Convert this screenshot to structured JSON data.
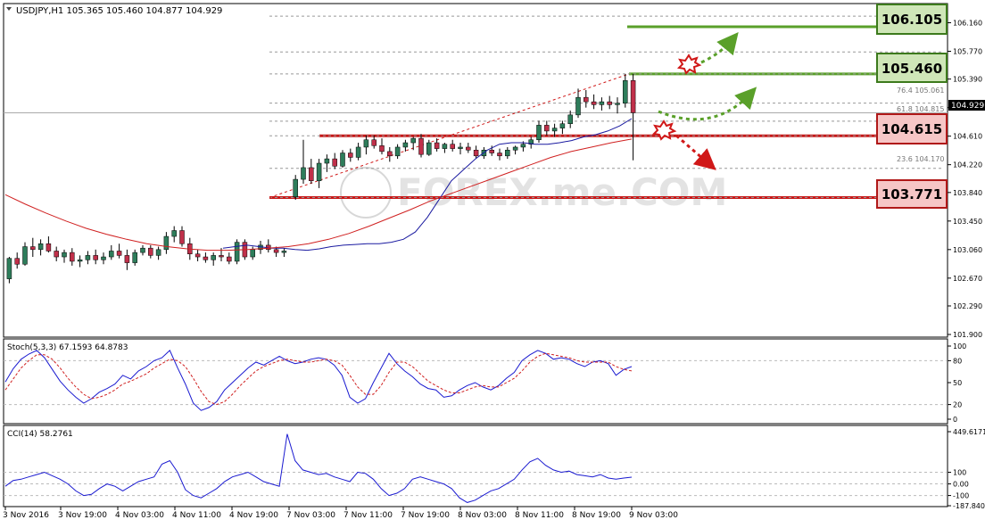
{
  "header": {
    "main_info": "USDJPY,H1  105.365 105.460 104.877 104.929",
    "stoch_info": "Stoch(5,3,3) 67.1593 64.8783",
    "cci_info": "CCI(14) 58.2761"
  },
  "watermark": "FOREX.me.COM",
  "colors": {
    "bull_candle": "#2e7d5b",
    "bear_candle": "#c0304a",
    "ma_fast": "#1a1aa0",
    "ma_slow": "#d02020",
    "resistance": "#5aa02a",
    "support": "#c81818",
    "resistance_label_bg": "#cfe6b8",
    "support_label_bg": "#f6c6c6",
    "indicator_line": "#1a1ad0",
    "signal_line": "#d02020"
  },
  "chart_data": [
    {
      "type": "candlestick",
      "symbol": "USDJPY",
      "timeframe": "H1",
      "ylim": [
        101.9,
        106.3
      ],
      "y_ticks": [
        "106.160",
        "105.770",
        "105.390",
        "105.000",
        "104.610",
        "104.220",
        "103.840",
        "103.450",
        "103.060",
        "102.670",
        "102.290",
        "101.900"
      ],
      "x_ticks": [
        "3 Nov 2016",
        "3 Nov 19:00",
        "4 Nov 03:00",
        "4 Nov 11:00",
        "4 Nov 19:00",
        "7 Nov 03:00",
        "7 Nov 11:00",
        "7 Nov 19:00",
        "8 Nov 03:00",
        "8 Nov 11:00",
        "8 Nov 19:00",
        "9 Nov 03:00"
      ],
      "current_price": "104.929",
      "levels": [
        {
          "label": "106.105",
          "kind": "resistance"
        },
        {
          "label": "105.460",
          "kind": "resistance"
        },
        {
          "label": "104.615",
          "kind": "support"
        },
        {
          "label": "103.771",
          "kind": "support"
        }
      ],
      "fibonacci": [
        {
          "label": "76.4",
          "price": "105.061"
        },
        {
          "label": "61.8",
          "price": "104.815"
        },
        {
          "label": "23.6",
          "price": "104.170"
        }
      ],
      "series": [
        {
          "name": "fast MA",
          "values": [
            103.08,
            103.1,
            103.12,
            103.1,
            103.08,
            103.08,
            103.06,
            103.05,
            103.07,
            103.1,
            103.12,
            103.13,
            103.14,
            103.14,
            103.16,
            103.2,
            103.3,
            103.5,
            103.75,
            104.0,
            104.15,
            104.3,
            104.42,
            104.5,
            104.52,
            104.52,
            104.5,
            104.5,
            104.52,
            104.55,
            104.6,
            104.63,
            104.68,
            104.75,
            104.85
          ]
        },
        {
          "name": "slow MA",
          "values": [
            103.81,
            103.68,
            103.56,
            103.45,
            103.35,
            103.27,
            103.2,
            103.14,
            103.1,
            103.07,
            103.05,
            103.05,
            103.06,
            103.08,
            103.1,
            103.14,
            103.2,
            103.28,
            103.38,
            103.49,
            103.6,
            103.72,
            103.82,
            103.92,
            104.02,
            104.12,
            104.22,
            104.32,
            104.4,
            104.46,
            104.52,
            104.57
          ]
        }
      ],
      "candles": [
        [
          102.66,
          102.96,
          102.6,
          102.94
        ],
        [
          102.94,
          103.02,
          102.8,
          102.86
        ],
        [
          102.86,
          103.16,
          102.84,
          103.1
        ],
        [
          103.1,
          103.22,
          102.96,
          103.06
        ],
        [
          103.06,
          103.2,
          102.98,
          103.14
        ],
        [
          103.14,
          103.24,
          103.02,
          103.04
        ],
        [
          103.04,
          103.1,
          102.9,
          102.96
        ],
        [
          102.96,
          103.06,
          102.88,
          103.02
        ],
        [
          103.02,
          103.08,
          102.84,
          102.9
        ],
        [
          102.9,
          102.98,
          102.82,
          102.92
        ],
        [
          102.92,
          103.04,
          102.86,
          102.98
        ],
        [
          102.98,
          103.06,
          102.86,
          102.92
        ],
        [
          102.92,
          103.02,
          102.86,
          102.96
        ],
        [
          102.96,
          103.12,
          102.92,
          103.04
        ],
        [
          103.04,
          103.14,
          102.94,
          102.98
        ],
        [
          102.98,
          103.06,
          102.78,
          102.88
        ],
        [
          102.88,
          103.06,
          102.84,
          103.02
        ],
        [
          103.02,
          103.12,
          102.98,
          103.08
        ],
        [
          103.08,
          103.12,
          102.94,
          102.98
        ],
        [
          102.98,
          103.1,
          102.92,
          103.06
        ],
        [
          103.06,
          103.3,
          103.0,
          103.24
        ],
        [
          103.24,
          103.38,
          103.16,
          103.32
        ],
        [
          103.32,
          103.38,
          103.1,
          103.14
        ],
        [
          103.14,
          103.22,
          102.92,
          103.0
        ],
        [
          103.0,
          103.06,
          102.9,
          102.96
        ],
        [
          102.96,
          103.02,
          102.88,
          102.92
        ],
        [
          102.92,
          103.02,
          102.84,
          102.98
        ],
        [
          102.98,
          103.08,
          102.9,
          102.96
        ],
        [
          102.96,
          103.02,
          102.86,
          102.9
        ],
        [
          102.9,
          103.2,
          102.86,
          103.16
        ],
        [
          103.16,
          103.2,
          102.92,
          102.96
        ],
        [
          102.96,
          103.1,
          102.92,
          103.06
        ],
        [
          103.06,
          103.18,
          103.0,
          103.12
        ],
        [
          103.12,
          103.2,
          103.02,
          103.06
        ],
        [
          103.06,
          103.1,
          102.96,
          103.02
        ],
        [
          103.02,
          103.08,
          102.96,
          103.04
        ],
        [
          103.78,
          104.08,
          103.74,
          104.02
        ],
        [
          104.02,
          104.56,
          103.96,
          104.18
        ],
        [
          104.18,
          104.3,
          103.96,
          104.0
        ],
        [
          104.0,
          104.3,
          103.9,
          104.24
        ],
        [
          104.24,
          104.36,
          104.12,
          104.3
        ],
        [
          104.3,
          104.38,
          104.16,
          104.2
        ],
        [
          104.2,
          104.42,
          104.18,
          104.38
        ],
        [
          104.38,
          104.44,
          104.26,
          104.32
        ],
        [
          104.32,
          104.52,
          104.28,
          104.46
        ],
        [
          104.46,
          104.62,
          104.36,
          104.56
        ],
        [
          104.56,
          104.62,
          104.44,
          104.48
        ],
        [
          104.48,
          104.58,
          104.36,
          104.4
        ],
        [
          104.4,
          104.46,
          104.26,
          104.34
        ],
        [
          104.34,
          104.5,
          104.3,
          104.46
        ],
        [
          104.46,
          104.56,
          104.4,
          104.52
        ],
        [
          104.52,
          104.6,
          104.42,
          104.58
        ],
        [
          104.58,
          104.64,
          104.32,
          104.36
        ],
        [
          104.36,
          104.56,
          104.34,
          104.52
        ],
        [
          104.52,
          104.58,
          104.4,
          104.44
        ],
        [
          104.44,
          104.52,
          104.38,
          104.5
        ],
        [
          104.5,
          104.56,
          104.4,
          104.44
        ],
        [
          104.44,
          104.52,
          104.36,
          104.46
        ],
        [
          104.46,
          104.52,
          104.38,
          104.42
        ],
        [
          104.42,
          104.48,
          104.3,
          104.34
        ],
        [
          104.34,
          104.46,
          104.3,
          104.42
        ],
        [
          104.42,
          104.48,
          104.34,
          104.38
        ],
        [
          104.38,
          104.44,
          104.28,
          104.34
        ],
        [
          104.34,
          104.46,
          104.3,
          104.42
        ],
        [
          104.42,
          104.48,
          104.36,
          104.46
        ],
        [
          104.46,
          104.54,
          104.4,
          104.5
        ],
        [
          104.5,
          104.6,
          104.44,
          104.56
        ],
        [
          104.56,
          104.82,
          104.52,
          104.76
        ],
        [
          104.76,
          104.82,
          104.62,
          104.68
        ],
        [
          104.68,
          104.78,
          104.6,
          104.72
        ],
        [
          104.72,
          104.82,
          104.64,
          104.78
        ],
        [
          104.78,
          104.96,
          104.72,
          104.9
        ],
        [
          104.9,
          105.26,
          104.86,
          105.14
        ],
        [
          105.14,
          105.24,
          105.0,
          105.08
        ],
        [
          105.08,
          105.18,
          104.98,
          105.04
        ],
        [
          105.04,
          105.14,
          104.96,
          105.08
        ],
        [
          105.08,
          105.16,
          104.98,
          105.04
        ],
        [
          105.04,
          105.14,
          104.92,
          105.06
        ],
        [
          105.06,
          105.46,
          105.0,
          105.37
        ],
        [
          105.37,
          105.46,
          104.28,
          104.93
        ]
      ]
    },
    {
      "type": "line",
      "title": "Stoch(5,3,3) 67.1593 64.8783",
      "ylim": [
        0,
        100
      ],
      "y_ticks": [
        "100",
        "80",
        "50",
        "20",
        "0"
      ],
      "series": [
        {
          "name": "main",
          "values": [
            51,
            69,
            82,
            89,
            94,
            84,
            68,
            52,
            40,
            30,
            22,
            28,
            37,
            42,
            48,
            60,
            55,
            66,
            72,
            80,
            84,
            94,
            70,
            48,
            22,
            12,
            16,
            24,
            40,
            50,
            60,
            70,
            78,
            74,
            80,
            86,
            80,
            76,
            78,
            82,
            84,
            82,
            74,
            60,
            30,
            22,
            28,
            50,
            70,
            90,
            76,
            66,
            58,
            48,
            42,
            40,
            30,
            32,
            40,
            46,
            50,
            44,
            40,
            46,
            56,
            64,
            80,
            88,
            94,
            90,
            82,
            84,
            82,
            76,
            72,
            78,
            80,
            76,
            60,
            68,
            72
          ]
        },
        {
          "name": "signal",
          "values": [
            40,
            55,
            70,
            80,
            88,
            88,
            82,
            70,
            56,
            44,
            34,
            28,
            30,
            34,
            40,
            48,
            52,
            57,
            62,
            70,
            76,
            82,
            80,
            72,
            56,
            38,
            24,
            20,
            24,
            34,
            46,
            56,
            66,
            72,
            76,
            80,
            82,
            80,
            78,
            78,
            80,
            82,
            80,
            74,
            60,
            44,
            34,
            34,
            46,
            64,
            78,
            78,
            72,
            62,
            52,
            46,
            40,
            36,
            36,
            40,
            44,
            46,
            44,
            44,
            50,
            56,
            66,
            78,
            86,
            90,
            88,
            86,
            84,
            80,
            78,
            78,
            78,
            78,
            72,
            68,
            66
          ]
        }
      ]
    },
    {
      "type": "line",
      "title": "CCI(14) 58.2761",
      "ylim": [
        -180,
        449.6171
      ],
      "y_ticks": [
        "449.6171",
        "100",
        "0.00",
        "-100",
        "-187.840"
      ],
      "series": [
        {
          "name": "CCI",
          "values": [
            -20,
            30,
            40,
            60,
            80,
            100,
            70,
            40,
            0,
            -60,
            -100,
            -90,
            -40,
            0,
            -20,
            -60,
            -20,
            20,
            40,
            60,
            170,
            200,
            100,
            -50,
            -100,
            -120,
            -80,
            -40,
            20,
            60,
            80,
            100,
            60,
            20,
            0,
            -20,
            430,
            200,
            120,
            100,
            80,
            90,
            60,
            40,
            20,
            100,
            90,
            40,
            -40,
            -100,
            -80,
            -40,
            40,
            60,
            40,
            20,
            0,
            -40,
            -120,
            -160,
            -140,
            -100,
            -60,
            -40,
            0,
            40,
            120,
            190,
            220,
            160,
            120,
            100,
            110,
            80,
            70,
            60,
            80,
            50,
            40,
            50,
            58
          ]
        }
      ]
    }
  ]
}
